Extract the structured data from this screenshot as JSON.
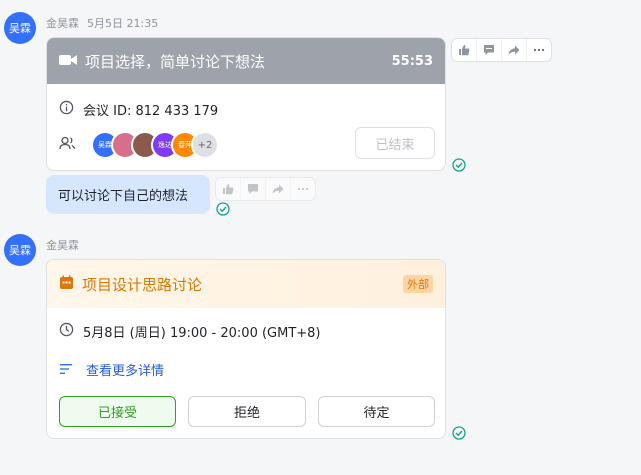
{
  "message1": {
    "avatar_text": "吴霖",
    "sender": "金昊霖",
    "time": "5月5日 21:35",
    "meeting_card": {
      "title": "项目选择，简单讨论下想法",
      "duration": "55:53",
      "meeting_id_label": "会议 ID: 812 433 179",
      "participants": [
        {
          "text": "吴霖",
          "color": "#3370ff"
        },
        {
          "text": "",
          "color": "#d86f8a"
        },
        {
          "text": "",
          "color": "#8a5a4a"
        },
        {
          "text": "逸达",
          "color": "#7f3bf5"
        },
        {
          "text": "春萍",
          "color": "#ff8800"
        }
      ],
      "more_count": "+2",
      "ended_button": "已结束"
    }
  },
  "message2": {
    "text": "可以讨论下自己的想法"
  },
  "message3": {
    "avatar_text": "吴霖",
    "sender": "金昊霖",
    "calendar_card": {
      "title": "项目设计思路讨论",
      "external_badge": "外部",
      "time_text": "5月8日 (周日) 19:00 - 20:00 (GMT+8)",
      "details_link": "查看更多详情",
      "accept_button": "已接受",
      "decline_button": "拒绝",
      "tentative_button": "待定"
    }
  },
  "colors": {
    "accent": "#3370ff",
    "read_check": "#14a38b",
    "calendar_orange": "#de7802",
    "accepted_green": "#2ea121"
  }
}
